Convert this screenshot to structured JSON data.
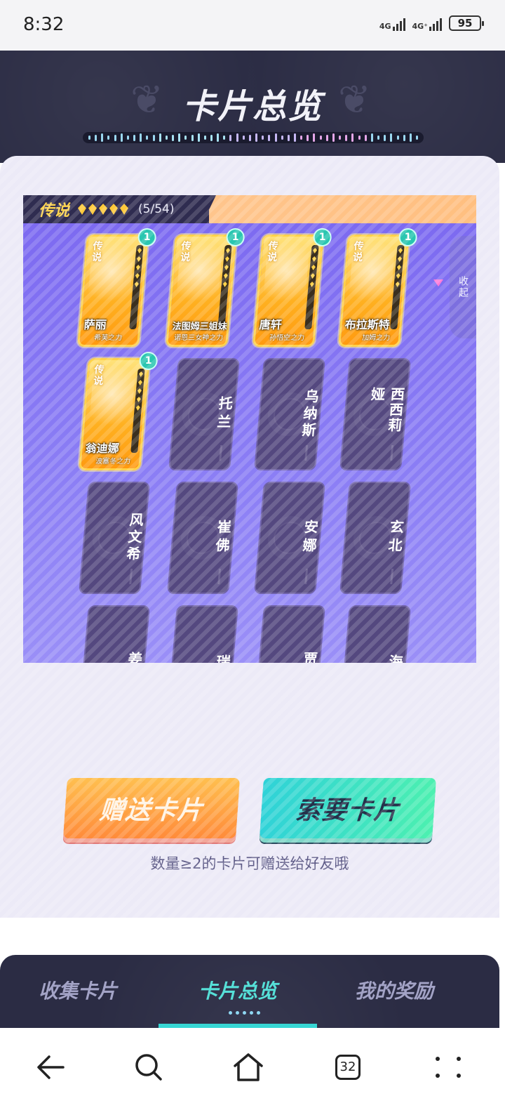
{
  "status_bar": {
    "time": "8:32",
    "network1": "4G",
    "network2": "4G⁺",
    "battery": "95"
  },
  "header": {
    "title": "卡片总览"
  },
  "rarity": {
    "label": "传说",
    "stars": 5,
    "count": "(5/54)"
  },
  "collapse_label": "收起",
  "owned_cards": [
    {
      "tag": "传说",
      "name": "萨丽",
      "sub": "希芙之力",
      "count": "1"
    },
    {
      "tag": "传说",
      "name": "法图姆三姐妹",
      "sub": "诺恩三女神之力",
      "count": "1"
    },
    {
      "tag": "传说",
      "name": "唐轩",
      "sub": "孙悟空之力",
      "count": "1"
    },
    {
      "tag": "传说",
      "name": "布拉斯特",
      "sub": "加姆之力",
      "count": "1"
    },
    {
      "tag": "传说",
      "name": "翁迪娜",
      "sub": "波塞冬之力",
      "count": "1"
    }
  ],
  "locked_cards": [
    {
      "name": "托兰"
    },
    {
      "name": "乌纳斯"
    },
    {
      "name": "西西莉娅"
    },
    {
      "name": "风文希"
    },
    {
      "name": "崔佛"
    },
    {
      "name": "安娜"
    },
    {
      "name": "玄北"
    },
    {
      "name": "姜力"
    },
    {
      "name": "瑞"
    },
    {
      "name": "贾维"
    },
    {
      "name": "海"
    }
  ],
  "buttons": {
    "gift": "赠送卡片",
    "ask": "索要卡片"
  },
  "tip": "数量≥2的卡片可赠送给好友哦",
  "tabs": {
    "collect": "收集卡片",
    "overview": "卡片总览",
    "rewards": "我的奖励"
  },
  "nav": {
    "tabs_count": "32"
  },
  "colors": {
    "accent_teal": "#37d7d4",
    "gold": "#ffc93a",
    "panel_purple": "#7b68f0",
    "dark_navy": "#2b2c44"
  }
}
